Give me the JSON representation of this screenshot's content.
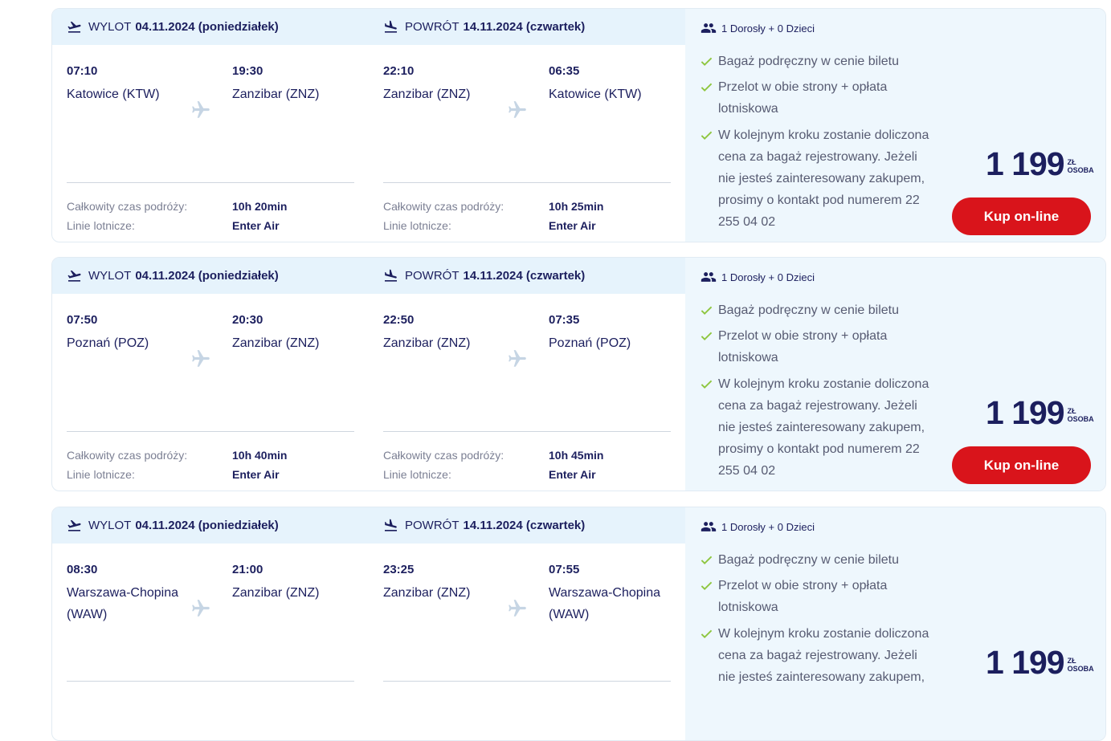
{
  "colors": {
    "accent_red": "#d9141b",
    "navy": "#1c1f5e",
    "header_blue": "#e6f3fc",
    "check_green": "#8ec63f"
  },
  "offers": [
    {
      "outbound": {
        "label": "WYLOT",
        "date": "04.11.2024 (poniedziałek)",
        "dep_time": "07:10",
        "dep_city": "Katowice (KTW)",
        "arr_time": "19:30",
        "arr_city": "Zanzibar (ZNZ)",
        "duration_label": "Całkowity czas podróży:",
        "duration": "10h 20min",
        "airline_label": "Linie lotnicze:",
        "airline": "Enter Air"
      },
      "return": {
        "label": "POWRÓT",
        "date": "14.11.2024 (czwartek)",
        "dep_time": "22:10",
        "dep_city": "Zanzibar (ZNZ)",
        "arr_time": "06:35",
        "arr_city": "Katowice (KTW)",
        "duration_label": "Całkowity czas podróży:",
        "duration": "10h 25min",
        "airline_label": "Linie lotnicze:",
        "airline": "Enter Air"
      },
      "passengers": "1 Dorosły + 0 Dzieci",
      "features": [
        "Bagaż podręczny w cenie biletu",
        "Przelot w obie strony + opłata lotniskowa",
        "W kolejnym kroku zostanie doliczona cena za bagaż rejestrowany. Jeżeli nie jesteś zainteresowany zakupem, prosimy o kontakt pod numerem 22 255 04 02"
      ],
      "price": "1 199",
      "currency": "ZŁ",
      "per": "OSOBA",
      "buy_label": "Kup on-line"
    },
    {
      "outbound": {
        "label": "WYLOT",
        "date": "04.11.2024 (poniedziałek)",
        "dep_time": "07:50",
        "dep_city": "Poznań (POZ)",
        "arr_time": "20:30",
        "arr_city": "Zanzibar (ZNZ)",
        "duration_label": "Całkowity czas podróży:",
        "duration": "10h 40min",
        "airline_label": "Linie lotnicze:",
        "airline": "Enter Air"
      },
      "return": {
        "label": "POWRÓT",
        "date": "14.11.2024 (czwartek)",
        "dep_time": "22:50",
        "dep_city": "Zanzibar (ZNZ)",
        "arr_time": "07:35",
        "arr_city": "Poznań (POZ)",
        "duration_label": "Całkowity czas podróży:",
        "duration": "10h 45min",
        "airline_label": "Linie lotnicze:",
        "airline": "Enter Air"
      },
      "passengers": "1 Dorosły + 0 Dzieci",
      "features": [
        "Bagaż podręczny w cenie biletu",
        "Przelot w obie strony + opłata lotniskowa",
        "W kolejnym kroku zostanie doliczona cena za bagaż rejestrowany. Jeżeli nie jesteś zainteresowany zakupem, prosimy o kontakt pod numerem 22 255 04 02"
      ],
      "price": "1 199",
      "currency": "ZŁ",
      "per": "OSOBA",
      "buy_label": "Kup on-line"
    },
    {
      "outbound": {
        "label": "WYLOT",
        "date": "04.11.2024 (poniedziałek)",
        "dep_time": "08:30",
        "dep_city": "Warszawa-Chopina (WAW)",
        "arr_time": "21:00",
        "arr_city": "Zanzibar (ZNZ)",
        "duration_label": "",
        "duration": "",
        "airline_label": "",
        "airline": ""
      },
      "return": {
        "label": "POWRÓT",
        "date": "14.11.2024 (czwartek)",
        "dep_time": "23:25",
        "dep_city": "Zanzibar (ZNZ)",
        "arr_time": "07:55",
        "arr_city": "Warszawa-Chopina (WAW)",
        "duration_label": "",
        "duration": "",
        "airline_label": "",
        "airline": ""
      },
      "passengers": "1 Dorosły + 0 Dzieci",
      "features": [
        "Bagaż podręczny w cenie biletu",
        "Przelot w obie strony + opłata lotniskowa",
        "W kolejnym kroku zostanie doliczona cena za bagaż rejestrowany. Jeżeli nie jesteś zainteresowany zakupem,"
      ],
      "price": "1 199",
      "currency": "ZŁ",
      "per": "OSOBA",
      "buy_label": ""
    }
  ]
}
